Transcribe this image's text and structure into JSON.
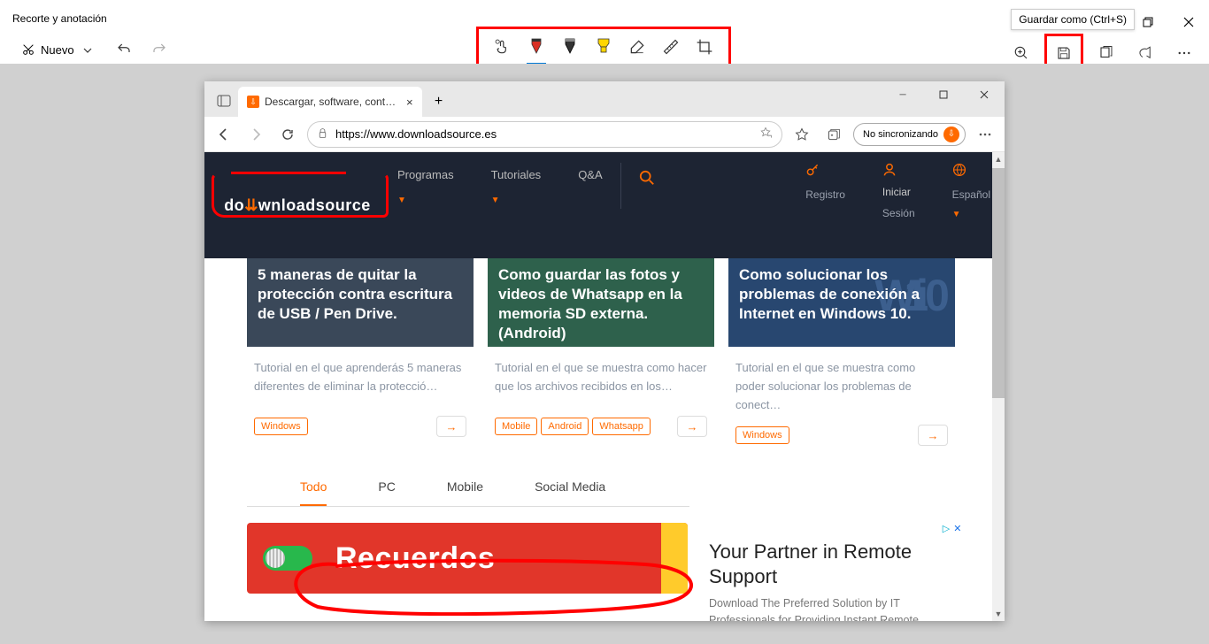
{
  "app": {
    "title": "Recorte y anotación",
    "new_label": "Nuevo",
    "save_tooltip": "Guardar como (Ctrl+S)"
  },
  "tools": {
    "touch": "touch-writing-icon",
    "pen_red": "ballpoint-pen-icon",
    "pencil": "pencil-icon",
    "highlighter": "highlighter-icon",
    "eraser": "eraser-icon",
    "ruler": "ruler-icon",
    "crop": "crop-icon"
  },
  "edge": {
    "tab_title": "Descargar, software, controlador",
    "url": "https://www.downloadsource.es",
    "sync_label": "No sincronizando"
  },
  "site": {
    "logo_left": "do",
    "logo_mid": "wnload",
    "logo_right": "source",
    "nav": {
      "programs": "Programas",
      "tutorials": "Tutoriales",
      "qa": "Q&A"
    },
    "right": {
      "login_top": "Iniciar",
      "login_bot": "Sesión",
      "register": "Registro",
      "lang": "Español"
    }
  },
  "cards": [
    {
      "title": "5 maneras de quitar la protección contra escritura de USB / Pen Drive.",
      "desc": "Tutorial en el que aprenderás 5 maneras diferentes de eliminar la protecció…",
      "tags": [
        "Windows"
      ]
    },
    {
      "title": "Como guardar las fotos y videos de Whatsapp en la memoria SD externa. (Android)",
      "desc": "Tutorial en el que se muestra como hacer que los archivos recibidos en los…",
      "tags": [
        "Mobile",
        "Android",
        "Whatsapp"
      ]
    },
    {
      "title": "Como solucionar los problemas de conexión a Internet en Windows 10.",
      "desc": "Tutorial en el que se muestra como poder solucionar los problemas de conect…",
      "tags": [
        "Windows"
      ]
    }
  ],
  "filters": {
    "all": "Todo",
    "pc": "PC",
    "mobile": "Mobile",
    "social": "Social Media"
  },
  "promo": {
    "text": "Recuerdos"
  },
  "ad": {
    "choice": "",
    "title": "Your Partner in Remote Support",
    "desc": "Download The Preferred Solution by IT Professionals for Providing Instant Remote Support."
  }
}
